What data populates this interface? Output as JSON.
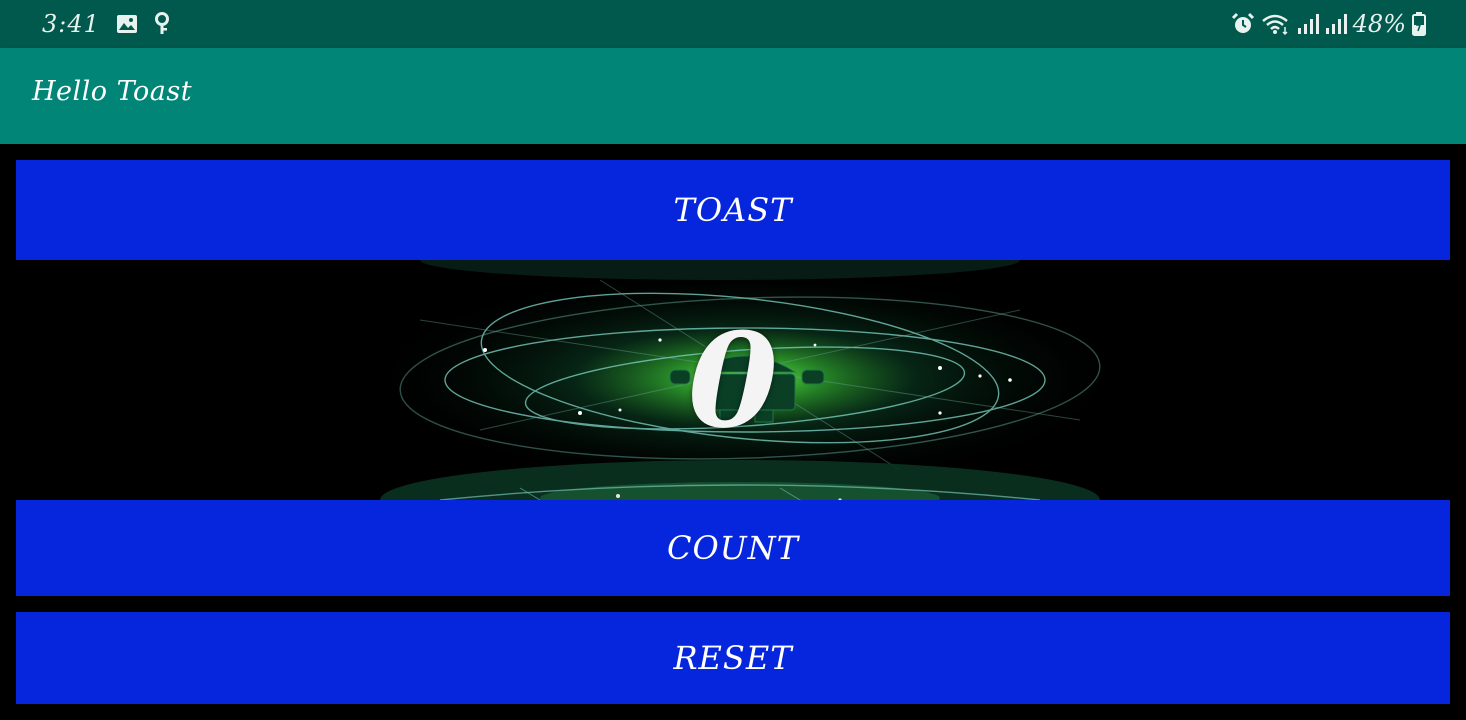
{
  "status_bar": {
    "time": "3:41",
    "battery_percent": "48%",
    "icons_left": [
      "image-icon",
      "location-icon"
    ],
    "icons_right": [
      "alarm-icon",
      "wifi-icon",
      "signal-icon",
      "signal-icon",
      "battery-icon"
    ]
  },
  "app_bar": {
    "title": "Hello Toast"
  },
  "main": {
    "toast_label": "TOAST",
    "count_value": "0",
    "count_label": "COUNT",
    "reset_label": "RESET"
  },
  "colors": {
    "status_bar": "#00594c",
    "app_bar": "#008577",
    "button": "#0626de",
    "background": "#000000",
    "glow": "#3dff4a"
  }
}
